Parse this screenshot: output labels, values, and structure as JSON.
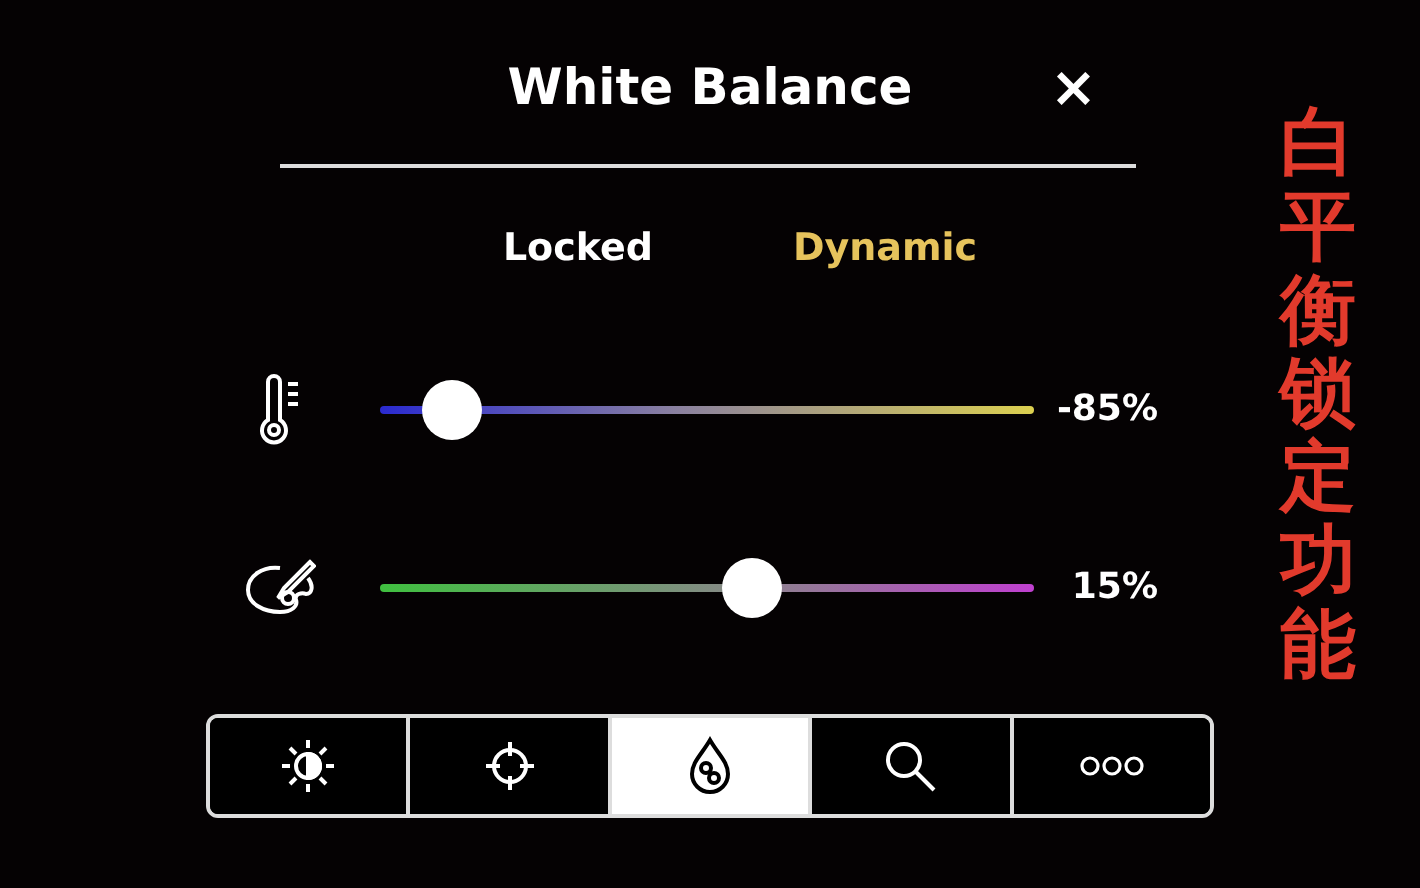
{
  "panel": {
    "title": "White Balance",
    "close": "×"
  },
  "modes": [
    {
      "label": "Locked",
      "selected": false
    },
    {
      "label": "Dynamic",
      "selected": true
    }
  ],
  "sliders": [
    {
      "kind": "temperature",
      "level": 0.11,
      "reading": "-85%"
    },
    {
      "kind": "tint",
      "level": 0.57,
      "reading": "15%"
    }
  ],
  "toolbar": [
    {
      "kind": "exposure",
      "selected": false
    },
    {
      "kind": "focus",
      "selected": false
    },
    {
      "kind": "white-balance",
      "selected": true
    },
    {
      "kind": "zoom",
      "selected": false
    },
    {
      "kind": "more",
      "selected": false
    }
  ],
  "caption": "白平衡锁定功能"
}
